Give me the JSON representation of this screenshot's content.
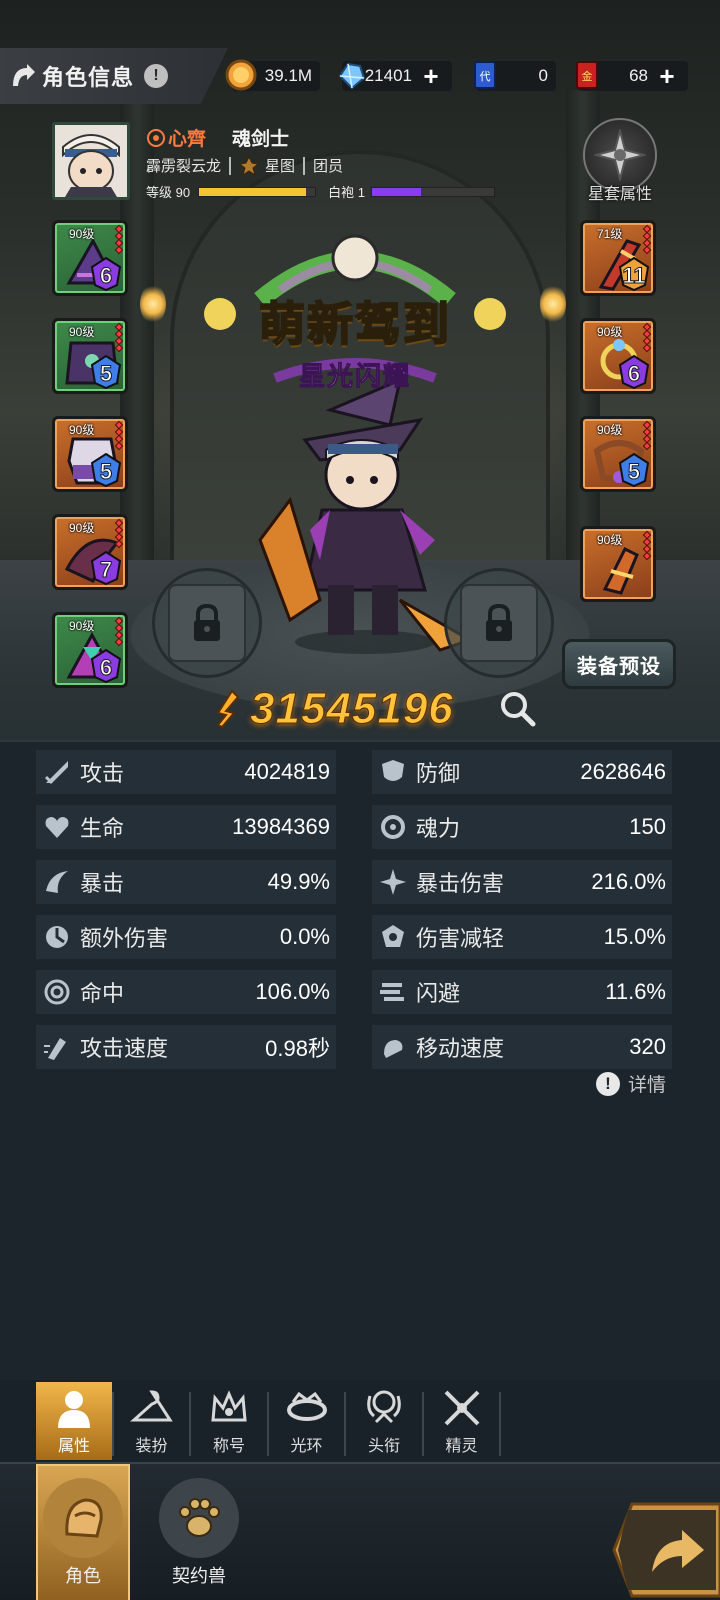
{
  "header": {
    "title": "角色信息",
    "info_mark": "!",
    "currencies": [
      {
        "icon": "gold-coin-icon",
        "value": "39.1M",
        "has_plus": false
      },
      {
        "icon": "crystal-icon",
        "value": "21401",
        "has_plus": true
      },
      {
        "icon": "voucher-card-icon",
        "value": "0",
        "has_plus": false
      },
      {
        "icon": "gold-card-icon",
        "value": "68",
        "has_plus": true
      }
    ],
    "plus": "+"
  },
  "character": {
    "name": "心齊",
    "class": "魂剑士",
    "title": "霹雳裂云龙",
    "star_map": "星图",
    "guild_role": "团员",
    "level_label": "等级 90",
    "level_progress": 0.92,
    "robe_label": "白袍 1",
    "robe_progress": 0.4
  },
  "star_set": {
    "label": "星套属性"
  },
  "banner": {
    "main": "萌新驾到",
    "sub": "星光闪耀"
  },
  "equipment": {
    "left": [
      {
        "level": "90级",
        "stars": "6",
        "rarity": "green"
      },
      {
        "level": "90级",
        "stars": "5",
        "rarity": "green"
      },
      {
        "level": "90级",
        "stars": "5",
        "rarity": "orange"
      },
      {
        "level": "90级",
        "stars": "7",
        "rarity": "orange"
      },
      {
        "level": "90级",
        "stars": "6",
        "rarity": "green"
      }
    ],
    "right": [
      {
        "level": "71级",
        "stars": "11",
        "rarity": "orange"
      },
      {
        "level": "90级",
        "stars": "6",
        "rarity": "orange"
      },
      {
        "level": "90级",
        "stars": "5",
        "rarity": "orange"
      },
      {
        "level": "90级",
        "stars": "",
        "rarity": "orange"
      }
    ],
    "preset_label": "装备预设"
  },
  "power": {
    "value": "31545196"
  },
  "stats": [
    {
      "icon": "sword-icon",
      "label": "攻击",
      "value": "4024819"
    },
    {
      "icon": "shield-icon",
      "label": "防御",
      "value": "2628646"
    },
    {
      "icon": "heart-icon",
      "label": "生命",
      "value": "13984369"
    },
    {
      "icon": "soul-icon",
      "label": "魂力",
      "value": "150"
    },
    {
      "icon": "crit-icon",
      "label": "暴击",
      "value": "49.9%"
    },
    {
      "icon": "crit-damage-icon",
      "label": "暴击伤害",
      "value": "216.0%"
    },
    {
      "icon": "extra-damage-icon",
      "label": "额外伤害",
      "value": "0.0%"
    },
    {
      "icon": "damage-reduction-icon",
      "label": "伤害减轻",
      "value": "15.0%"
    },
    {
      "icon": "target-icon",
      "label": "命中",
      "value": "106.0%"
    },
    {
      "icon": "dodge-icon",
      "label": "闪避",
      "value": "11.6%"
    },
    {
      "icon": "attack-speed-icon",
      "label": "攻击速度",
      "value": "0.98秒"
    },
    {
      "icon": "move-speed-icon",
      "label": "移动速度",
      "value": "320"
    }
  ],
  "details_label": "详情",
  "tabs": [
    {
      "icon": "person-icon",
      "label": "属性",
      "active": true
    },
    {
      "icon": "hanger-icon",
      "label": "装扮",
      "active": false
    },
    {
      "icon": "crown-icon",
      "label": "称号",
      "active": false
    },
    {
      "icon": "halo-icon",
      "label": "光环",
      "active": false
    },
    {
      "icon": "head-ornament-icon",
      "label": "头衔",
      "active": false
    },
    {
      "icon": "sprite-icon",
      "label": "精灵",
      "active": false
    }
  ],
  "bottom_nav": [
    {
      "icon": "character-icon",
      "label": "角色",
      "active": true
    },
    {
      "icon": "paw-icon",
      "label": "契约兽",
      "active": false
    }
  ],
  "colors": {
    "accent_gold": "#ffc23a",
    "name_orange": "#ff7a3c",
    "level_bar": "#f2c532",
    "robe_bar": "#8a3cf0",
    "panel_bg": "#1c252c",
    "stat_row_bg": "#242f37"
  }
}
